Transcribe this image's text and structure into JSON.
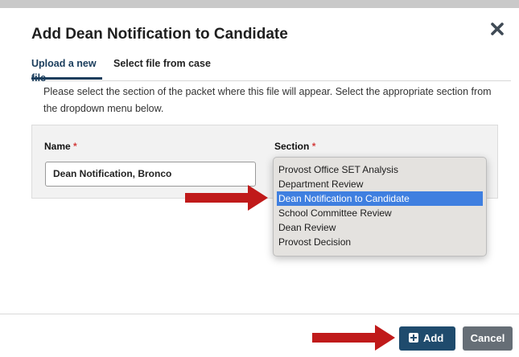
{
  "dialog": {
    "title": "Add Dean Notification to Candidate",
    "close_icon": "close-x-icon"
  },
  "tabs": [
    {
      "label": "Upload a new file",
      "active": true
    },
    {
      "label": "Select file from case",
      "active": false
    }
  ],
  "instructions": "Please select the section of the packet where this file will appear. Select the appropriate section from the dropdown menu below.",
  "form": {
    "name_label": "Name",
    "section_label": "Section",
    "required_marker": "*",
    "name_value": "Dean Notification, Bronco"
  },
  "section_dropdown": {
    "options": [
      "Provost Office SET Analysis",
      "Department Review",
      "Dean Notification to Candidate",
      "School Committee Review",
      "Dean Review",
      "Provost Decision"
    ],
    "selected": "Dean Notification to Candidate"
  },
  "buttons": {
    "add_label": "Add",
    "add_icon": "plus-square-icon",
    "cancel_label": "Cancel"
  },
  "colors": {
    "primary": "#1f4b6d",
    "selection": "#3f7fe0",
    "annotation_arrow": "#c01a1a",
    "required": "#d33c3c",
    "cancel": "#666e76"
  }
}
